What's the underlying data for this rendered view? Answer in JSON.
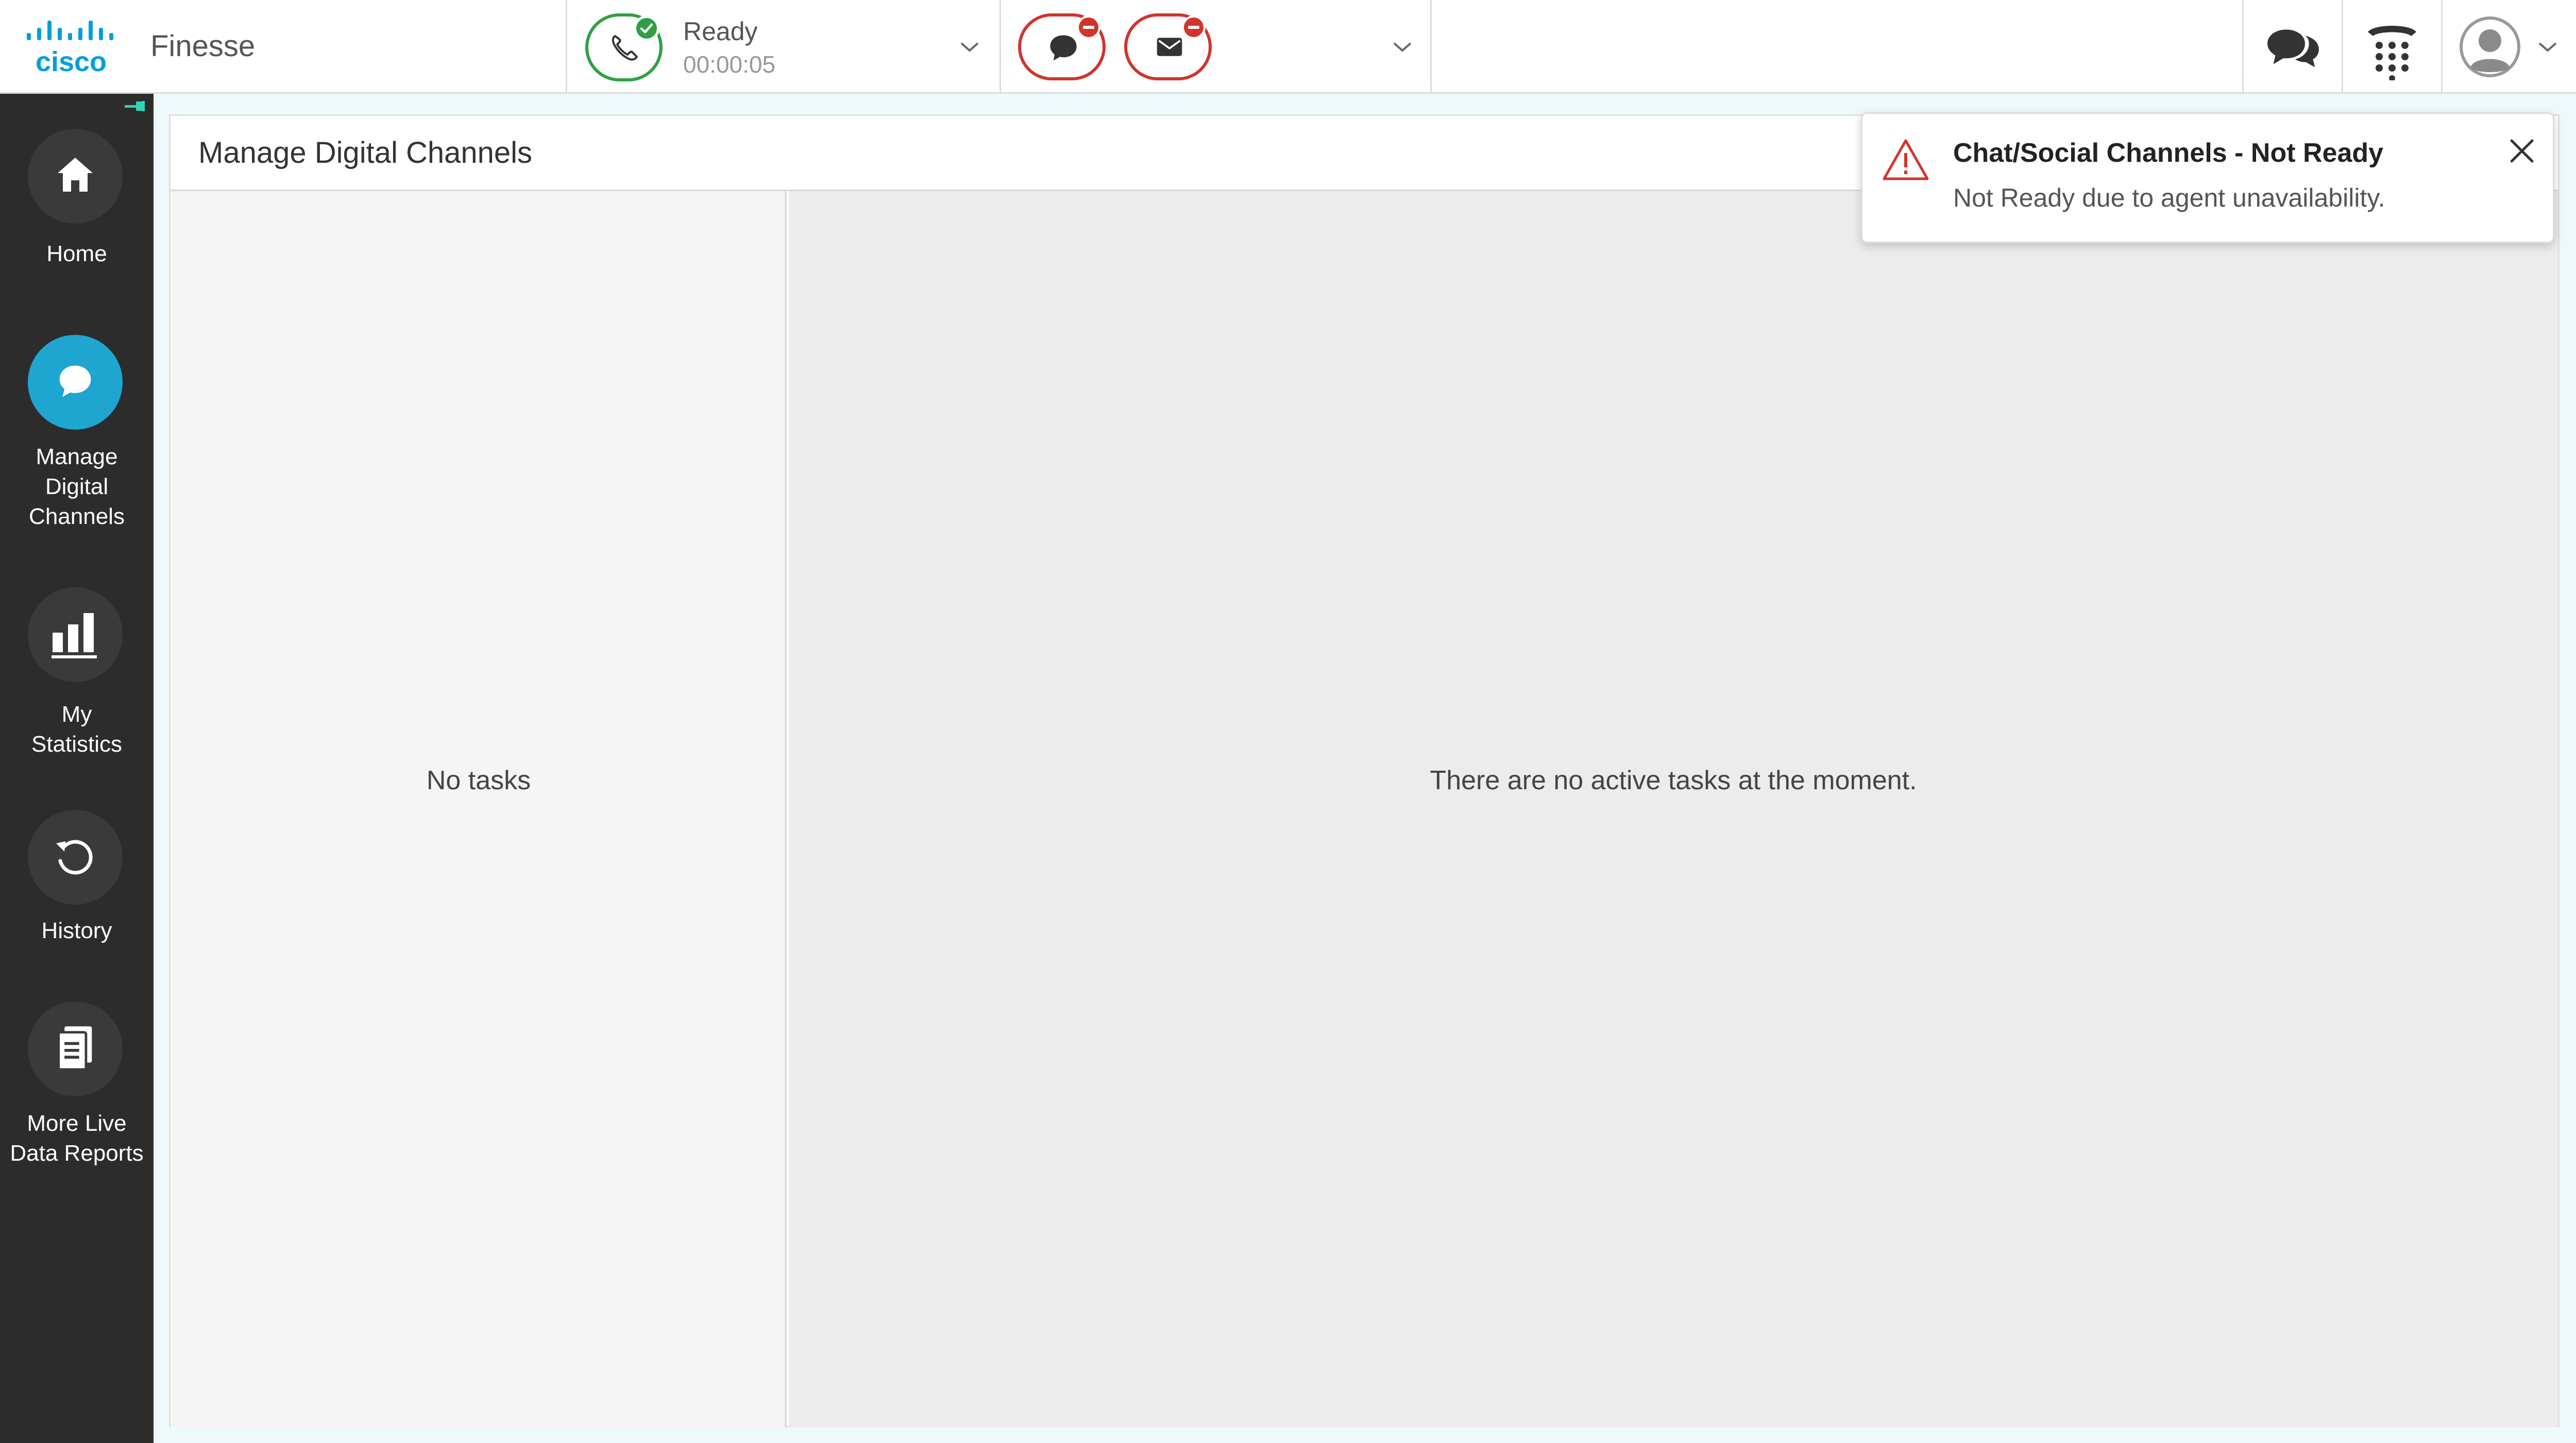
{
  "brand": {
    "logo_text": "cisco",
    "app_name": "Finesse",
    "accent": "#049fd9"
  },
  "voice": {
    "status": "Ready",
    "timer": "00:00:05",
    "status_color": "#2ea043"
  },
  "digital": {
    "status_color": "#d0342c"
  },
  "sidebar": {
    "items": [
      {
        "label": "Home",
        "icon": "home-icon"
      },
      {
        "label": "Manage\nDigital\nChannels",
        "icon": "chat-icon"
      },
      {
        "label": "My\nStatistics",
        "icon": "bar-chart-icon"
      },
      {
        "label": "History",
        "icon": "history-icon"
      },
      {
        "label": "More Live\nData Reports",
        "icon": "report-icon"
      }
    ]
  },
  "main": {
    "title": "Manage Digital Channels",
    "no_tasks": "No tasks",
    "no_active": "There are no active tasks at the moment."
  },
  "toast": {
    "title": "Chat/Social Channels - Not Ready",
    "message": "Not Ready due to agent unavailability."
  }
}
